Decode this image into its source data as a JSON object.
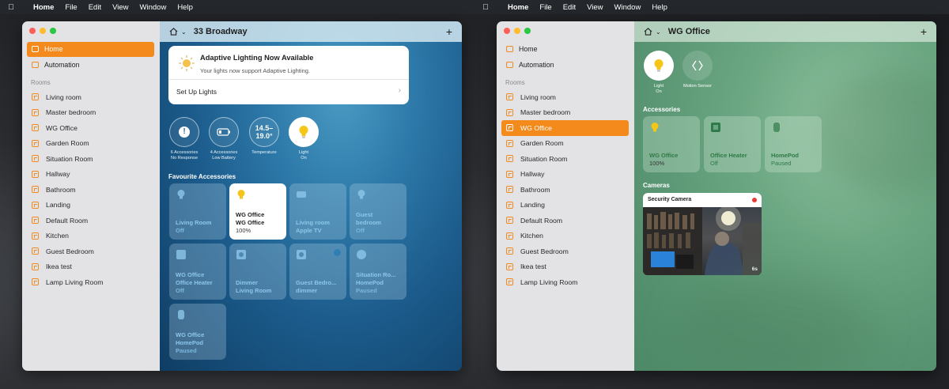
{
  "menubar": {
    "app": "Home",
    "items": [
      "File",
      "Edit",
      "View",
      "Window",
      "Help"
    ]
  },
  "sidebar": {
    "nav": [
      {
        "label": "Home"
      },
      {
        "label": "Automation"
      }
    ],
    "rooms_heading": "Rooms",
    "rooms": [
      "Living room",
      "Master bedroom",
      "WG Office",
      "Garden Room",
      "Situation Room",
      "Hallway",
      "Bathroom",
      "Landing",
      "Default Room",
      "Kitchen",
      "Guest Bedroom",
      "Ikea test",
      "Lamp Living Room"
    ]
  },
  "left": {
    "title": "33 Broadway",
    "banner": {
      "title": "Adaptive Lighting Now Available",
      "subtitle": "Your lights now support Adaptive Lighting.",
      "action": "Set Up Lights"
    },
    "status": [
      {
        "top": "!",
        "line1": "6 Accessories",
        "line2": "No Response"
      },
      {
        "top": "",
        "line1": "4 Accessories",
        "line2": "Low Battery"
      },
      {
        "top": "14.5–",
        "top2": "19.0°",
        "line1": "Temperature",
        "line2": ""
      },
      {
        "top": "",
        "line1": "Light",
        "line2": "On"
      }
    ],
    "section": "Favourite Accessories",
    "tiles": [
      {
        "l1": "Living Room",
        "l2": "",
        "st": "Off"
      },
      {
        "l1": "WG Office",
        "l2": "WG Office",
        "st": "100%"
      },
      {
        "l1": "Living room",
        "l2": "Apple TV",
        "st": ""
      },
      {
        "l1": "Guest",
        "l2": "bedroom",
        "st": "Off"
      },
      {
        "l1": "WG Office",
        "l2": "Office Heater",
        "st": "Off"
      },
      {
        "l1": "Dimmer",
        "l2": "Living Room",
        "st": ""
      },
      {
        "l1": "Guest Bedro...",
        "l2": "dimmer",
        "st": ""
      },
      {
        "l1": "Situation Ro...",
        "l2": "HomePod",
        "st": "Paused"
      },
      {
        "l1": "WG Office",
        "l2": "HomePod",
        "st": "Paused"
      }
    ]
  },
  "right": {
    "title": "WG Office",
    "devices": [
      {
        "l1": "Light",
        "l2": "On"
      },
      {
        "l1": "Motion Sensor",
        "l2": ""
      }
    ],
    "accessories_heading": "Accessories",
    "tiles": [
      {
        "l1": "WG Office",
        "st": "100%"
      },
      {
        "l1": "Office Heater",
        "st": "Off"
      },
      {
        "l1": "HomePod",
        "st": "Paused"
      }
    ],
    "cameras_heading": "Cameras",
    "camera": {
      "title": "Security Camera",
      "time": "6s"
    }
  },
  "colors": {
    "accent": "#f48a1c",
    "bulb": "#f5c518"
  }
}
